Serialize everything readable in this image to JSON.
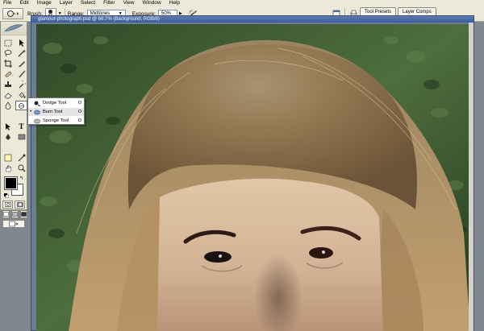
{
  "menu": [
    "File",
    "Edit",
    "Image",
    "Layer",
    "Select",
    "Filter",
    "View",
    "Window",
    "Help"
  ],
  "options": {
    "brush_label": "Brush:",
    "brush_size": "56",
    "range_label": "Range:",
    "range_value": "Midtones",
    "exposure_label": "Exposure:",
    "exposure_value": "50%"
  },
  "palette_well": {
    "tabs": [
      "Tool Presets",
      "Layer Comps"
    ]
  },
  "document": {
    "title": "glamour-photograph.psd @ 66.7% (Background, RGB/8)"
  },
  "flyout": {
    "items": [
      {
        "label": "Dodge Tool",
        "key": "O",
        "selected": false
      },
      {
        "label": "Burn Tool",
        "key": "O",
        "selected": true
      },
      {
        "label": "Sponge Tool",
        "key": "O",
        "selected": false
      }
    ],
    "selected_bullet": "•"
  },
  "colors": {
    "foreground": "#000000",
    "background": "#ffffff",
    "ui_chrome": "#ece9d8",
    "doc_title_bar": "#3b5d9c"
  }
}
